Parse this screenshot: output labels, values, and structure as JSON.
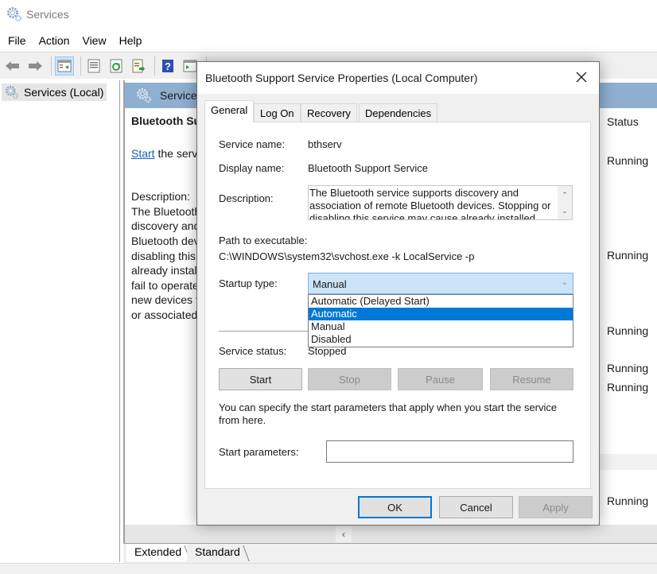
{
  "window": {
    "title": "Services",
    "app_icon": "gear-icon"
  },
  "menu": {
    "items": [
      "File",
      "Action",
      "View",
      "Help"
    ]
  },
  "toolbar": {
    "buttons": [
      {
        "name": "back",
        "icon": "arrow-left-icon"
      },
      {
        "name": "forward",
        "icon": "arrow-right-icon"
      },
      {
        "name": "show-hide-console-tree",
        "icon": "console-tree-icon",
        "active": true
      },
      {
        "name": "properties",
        "icon": "properties-icon"
      },
      {
        "name": "refresh",
        "icon": "refresh-icon"
      },
      {
        "name": "export-list",
        "icon": "export-icon"
      },
      {
        "name": "help",
        "icon": "help-icon"
      },
      {
        "name": "show-hide-action-pane",
        "icon": "action-pane-icon"
      },
      {
        "name": "start-service",
        "icon": "play-icon"
      },
      {
        "name": "stop-service",
        "icon": "stop-icon"
      },
      {
        "name": "pause-service",
        "icon": "pause-icon"
      },
      {
        "name": "restart-service",
        "icon": "restart-icon"
      }
    ]
  },
  "tree": {
    "items": [
      {
        "label": "Services (Local)",
        "icon": "gear-icon",
        "selected": true
      }
    ]
  },
  "main": {
    "header_label": "Services (Local)",
    "extended": {
      "title": "Bluetooth Support Service",
      "start_link": "Start",
      "start_suffix": " the service",
      "description_label": "Description:",
      "description_lines": [
        "The Bluetooth service supports",
        "discovery and association of remote",
        "Bluetooth devices. Stopping or",
        "disabling this service may cause",
        "already installed Bluetooth devices to",
        "fail to operate properly and prevent",
        "new devices from being discovered",
        "or associated."
      ]
    },
    "status_header": "Status",
    "status_rows": [
      "Running",
      "Running",
      "Running",
      "Running",
      "Running",
      "Running"
    ],
    "view_tabs": [
      {
        "label": "Extended",
        "active": true
      },
      {
        "label": "Standard",
        "active": false
      }
    ]
  },
  "dialog": {
    "title": "Bluetooth Support Service Properties (Local Computer)",
    "tabs": [
      {
        "label": "General",
        "active": true
      },
      {
        "label": "Log On",
        "active": false
      },
      {
        "label": "Recovery",
        "active": false
      },
      {
        "label": "Dependencies",
        "active": false
      }
    ],
    "general": {
      "service_name_label": "Service name:",
      "service_name": "bthserv",
      "display_name_label": "Display name:",
      "display_name": "Bluetooth Support Service",
      "description_label": "Description:",
      "description": "The Bluetooth service supports discovery and association of remote Bluetooth devices.  Stopping or disabling this service may cause already installed Bluetooth devices to fail to operate properly and prevent new devices from being discovered or associated.",
      "path_label": "Path to executable:",
      "path": "C:\\WINDOWS\\system32\\svchost.exe -k LocalService -p",
      "startup_type_label": "Startup type:",
      "startup_type_value": "Manual",
      "startup_options": [
        {
          "label": "Automatic (Delayed Start)",
          "highlighted": false
        },
        {
          "label": "Automatic",
          "highlighted": true
        },
        {
          "label": "Manual",
          "highlighted": false
        },
        {
          "label": "Disabled",
          "highlighted": false
        }
      ],
      "service_status_label": "Service status:",
      "service_status": "Stopped",
      "control_buttons": [
        {
          "label": "Start",
          "enabled": true
        },
        {
          "label": "Stop",
          "enabled": false
        },
        {
          "label": "Pause",
          "enabled": false
        },
        {
          "label": "Resume",
          "enabled": false
        }
      ],
      "note": "You can specify the start parameters that apply when you start the service from here.",
      "start_params_label": "Start parameters:",
      "start_params_value": ""
    },
    "buttons": {
      "ok": "OK",
      "cancel": "Cancel",
      "apply": "Apply"
    }
  },
  "colors": {
    "header_blue": "#8fafd0",
    "selection_blue": "#0078d7",
    "combo_focus": "#cce4f7",
    "link": "#1a5fb4"
  }
}
